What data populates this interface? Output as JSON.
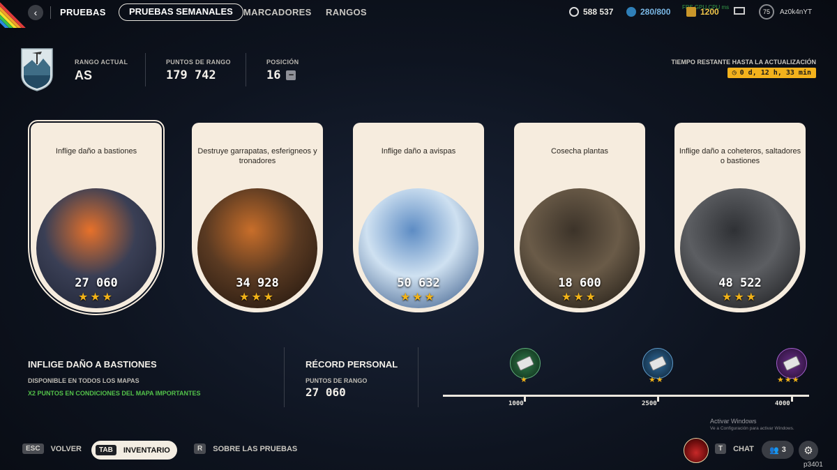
{
  "nav": {
    "title": "PRUEBAS",
    "tabs": [
      {
        "label": "PRUEBAS SEMANALES"
      },
      {
        "label": "MARCADORES"
      },
      {
        "label": "RANGOS"
      }
    ],
    "back_icon": "chevron-left-icon"
  },
  "stats": {
    "credits": "588 537",
    "cubes": "280/800",
    "gold": "1200",
    "level": "75",
    "username": "Az0k4nYT",
    "overlay": "FPS  GPU  CPU  ms"
  },
  "rank": {
    "current_label": "RANGO ACTUAL",
    "current_value": "AS",
    "points_label": "PUNTOS DE RANGO",
    "points_value": "179 742",
    "position_label": "POSICIÓN",
    "position_value": "16",
    "position_change": "−"
  },
  "timer": {
    "label": "TIEMPO RESTANTE HASTA LA ACTUALIZACIÓN",
    "value": "0 d, 12 h, 33 min"
  },
  "cards": [
    {
      "title": "Inflige daño a bastiones",
      "score": "27 060",
      "stars": 3,
      "colors": [
        "#3a3f55",
        "#e7712a",
        "#1b2030"
      ]
    },
    {
      "title": "Destruye garrapatas, esferigneos y tronadores",
      "score": "34 928",
      "stars": 3,
      "colors": [
        "#5a3a22",
        "#c86e2a",
        "#1b120c"
      ]
    },
    {
      "title": "Inflige daño a avispas",
      "score": "50 632",
      "stars": 3,
      "colors": [
        "#cfe1f1",
        "#5d8cc4",
        "#2c4f80"
      ]
    },
    {
      "title": "Cosecha plantas",
      "score": "18 600",
      "stars": 3,
      "colors": [
        "#6a5b48",
        "#3c3329",
        "#18140f"
      ]
    },
    {
      "title": "Inflige daño a coheteros, saltadores o bastiones",
      "score": "48 522",
      "stars": 3,
      "colors": [
        "#5c5e62",
        "#2f3135",
        "#141518"
      ]
    }
  ],
  "detail": {
    "title": "INFLIGE DAÑO A BASTIONES",
    "availability": "DISPONIBLE EN TODOS LOS MAPAS",
    "bonus": "X2 PUNTOS EN CONDICIONES DEL MAPA IMPORTANTES"
  },
  "record": {
    "title": "RÉCORD PERSONAL",
    "label": "PUNTOS DE RANGO",
    "value": "27 060"
  },
  "thresholds": [
    {
      "value": "1000",
      "stars": "★",
      "color": "#1d6b3a"
    },
    {
      "value": "2500",
      "stars": "★★",
      "color": "#1d4f7a"
    },
    {
      "value": "4000",
      "stars": "★★★",
      "color": "#5a1d6a"
    }
  ],
  "windows": {
    "activate": "Activar Windows",
    "activate_sub": "Ve a Configuración para activar Windows."
  },
  "footer": {
    "esc_key": "ESC",
    "back_label": "VOLVER",
    "tab_key": "TAB",
    "inventory_label": "INVENTARIO",
    "r_key": "R",
    "about_label": "SOBRE LAS PRUEBAS",
    "t_key": "T",
    "chat_label": "CHAT",
    "friends_count": "3",
    "player_id": "p3401"
  }
}
